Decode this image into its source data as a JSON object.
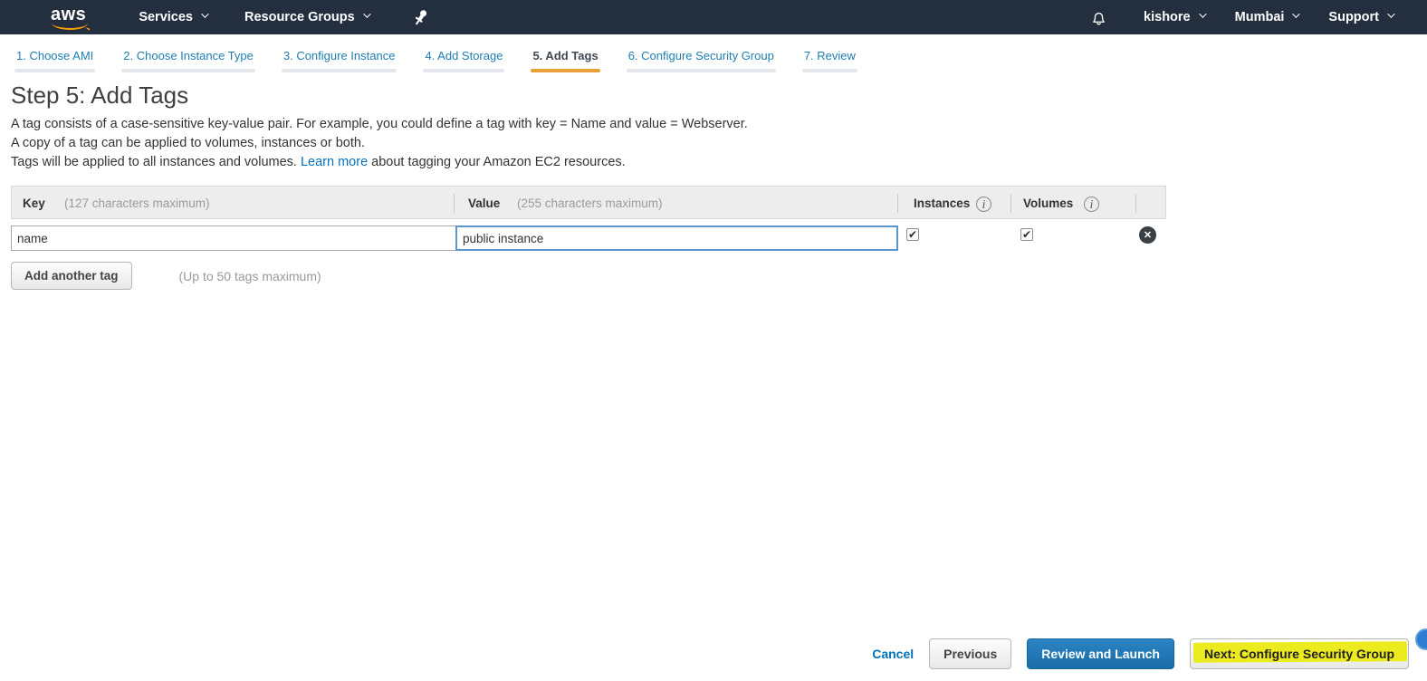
{
  "nav": {
    "logo_label": "aws",
    "services_label": "Services",
    "resource_groups_label": "Resource Groups",
    "user_label": "kishore",
    "region_label": "Mumbai",
    "support_label": "Support"
  },
  "tabs": [
    {
      "label": "1. Choose AMI",
      "active": false
    },
    {
      "label": "2. Choose Instance Type",
      "active": false
    },
    {
      "label": "3. Configure Instance",
      "active": false
    },
    {
      "label": "4. Add Storage",
      "active": false
    },
    {
      "label": "5. Add Tags",
      "active": true
    },
    {
      "label": "6. Configure Security Group",
      "active": false
    },
    {
      "label": "7. Review",
      "active": false
    }
  ],
  "page": {
    "title": "Step 5: Add Tags",
    "description_line1": "A tag consists of a case-sensitive key-value pair. For example, you could define a tag with key = Name and value = Webserver.",
    "description_line2": "A copy of a tag can be applied to volumes, instances or both.",
    "description_line3_prefix": "Tags will be applied to all instances and volumes. ",
    "learn_more_label": "Learn more",
    "description_line3_suffix": " about tagging your Amazon EC2 resources."
  },
  "tag_table": {
    "key_header": "Key",
    "key_hint": "(127 characters maximum)",
    "value_header": "Value",
    "value_hint": "(255 characters maximum)",
    "instances_header": "Instances",
    "volumes_header": "Volumes",
    "rows": [
      {
        "key": "name",
        "value": "public instance",
        "instances_checked": true,
        "volumes_checked": true
      }
    ]
  },
  "actions": {
    "add_tag_label": "Add another tag",
    "max_tags_hint": "(Up to 50 tags maximum)"
  },
  "footer": {
    "cancel_label": "Cancel",
    "previous_label": "Previous",
    "review_launch_label": "Review and Launch",
    "next_label": "Next: Configure Security Group"
  },
  "colors": {
    "nav_background": "#232f3e",
    "aws_orange": "#ff9900",
    "active_tab_underline": "#e9a23b",
    "link_blue": "#0073bb",
    "primary_button_blue": "#1a6ca8",
    "focused_input_border": "#5a96d2",
    "highlight_yellow": "#eceb1f"
  }
}
